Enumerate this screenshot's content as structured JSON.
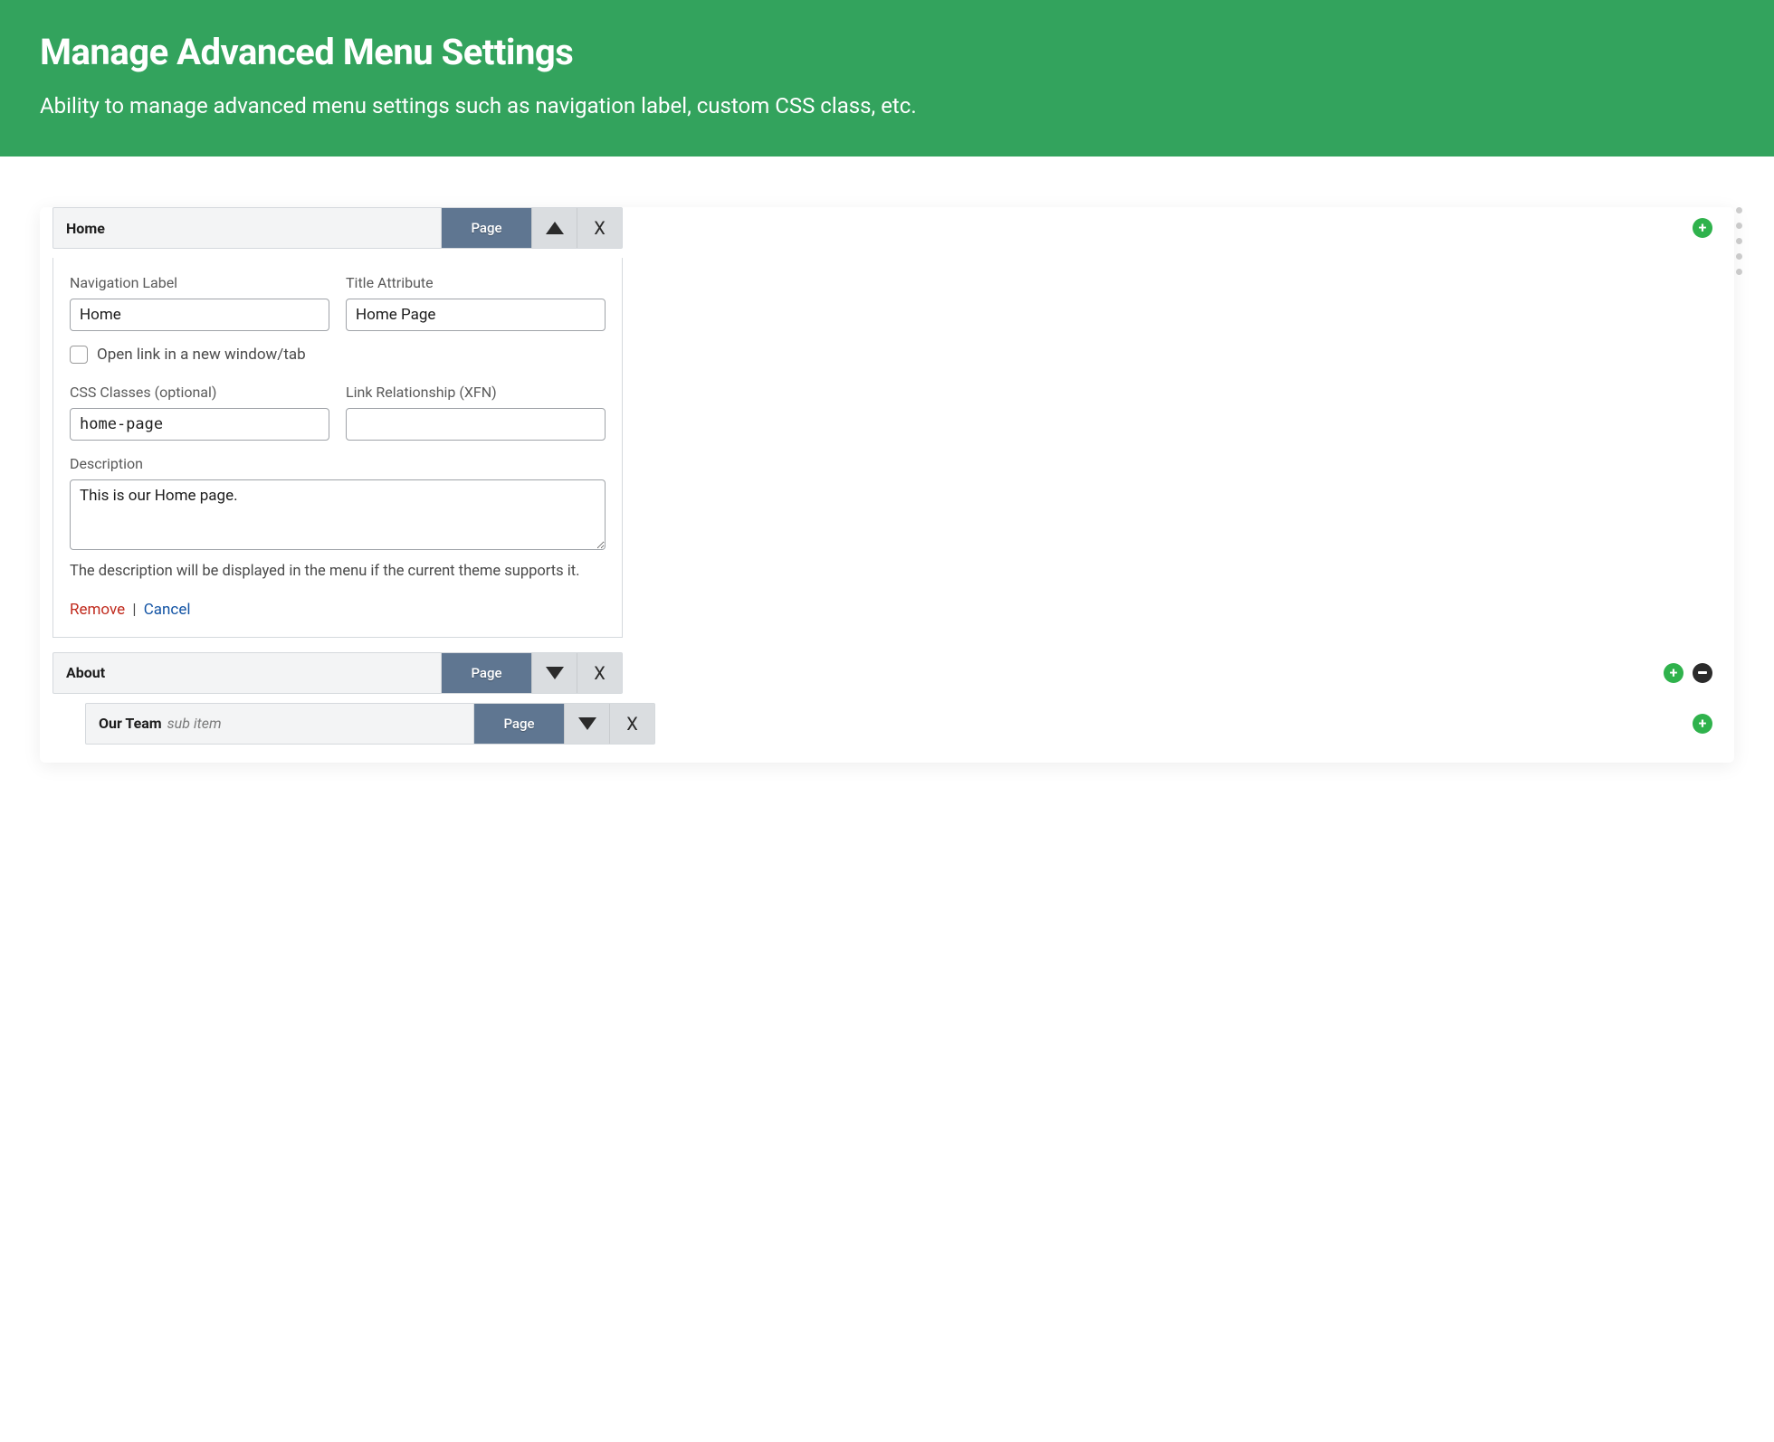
{
  "header": {
    "title": "Manage Advanced Menu Settings",
    "subtitle": "Ability to manage advanced menu settings such as navigation label, custom CSS class, etc."
  },
  "items": [
    {
      "title": "Home",
      "sub_label": "",
      "type": "Page",
      "expanded": true,
      "close": "X",
      "form": {
        "nav_label_label": "Navigation Label",
        "nav_label_value": "Home",
        "title_attr_label": "Title Attribute",
        "title_attr_value": "Home Page",
        "open_new_label": "Open link in a new window/tab",
        "open_new_checked": false,
        "css_label": "CSS Classes (optional)",
        "css_value": "home-page",
        "xfn_label": "Link Relationship (XFN)",
        "xfn_value": "",
        "desc_label": "Description",
        "desc_value": "This is our Home page.",
        "help": "The description will be displayed in the menu if the current theme supports it.",
        "remove": "Remove",
        "sep": " | ",
        "cancel": "Cancel"
      },
      "controls": {
        "plus": true,
        "minus": false
      }
    },
    {
      "title": "About",
      "sub_label": "",
      "type": "Page",
      "expanded": false,
      "close": "X",
      "controls": {
        "plus": true,
        "minus": true
      }
    },
    {
      "title": "Our Team",
      "sub_label": "sub item",
      "type": "Page",
      "expanded": false,
      "close": "X",
      "indent": true,
      "controls": {
        "plus": true,
        "minus": false
      }
    }
  ]
}
